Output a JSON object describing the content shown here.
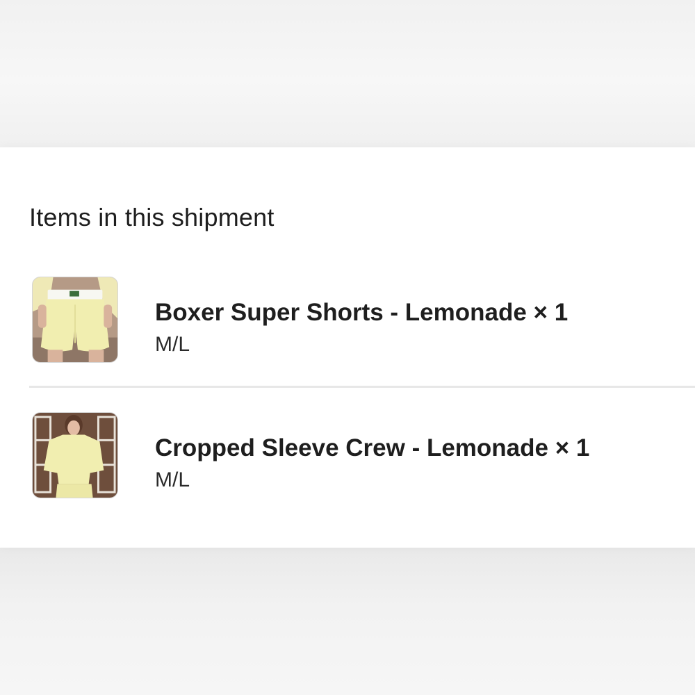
{
  "shipment": {
    "heading": "Items in this shipment",
    "items": [
      {
        "title": "Boxer Super Shorts - Lemonade × 1",
        "variant": "M/L",
        "image_icon": "product-photo-shorts"
      },
      {
        "title": "Cropped Sleeve Crew - Lemonade × 1",
        "variant": "M/L",
        "image_icon": "product-photo-crew"
      }
    ]
  },
  "colors": {
    "product": "#f1eeb0",
    "text": "#1e1e1e",
    "divider": "#e7e7e7"
  }
}
